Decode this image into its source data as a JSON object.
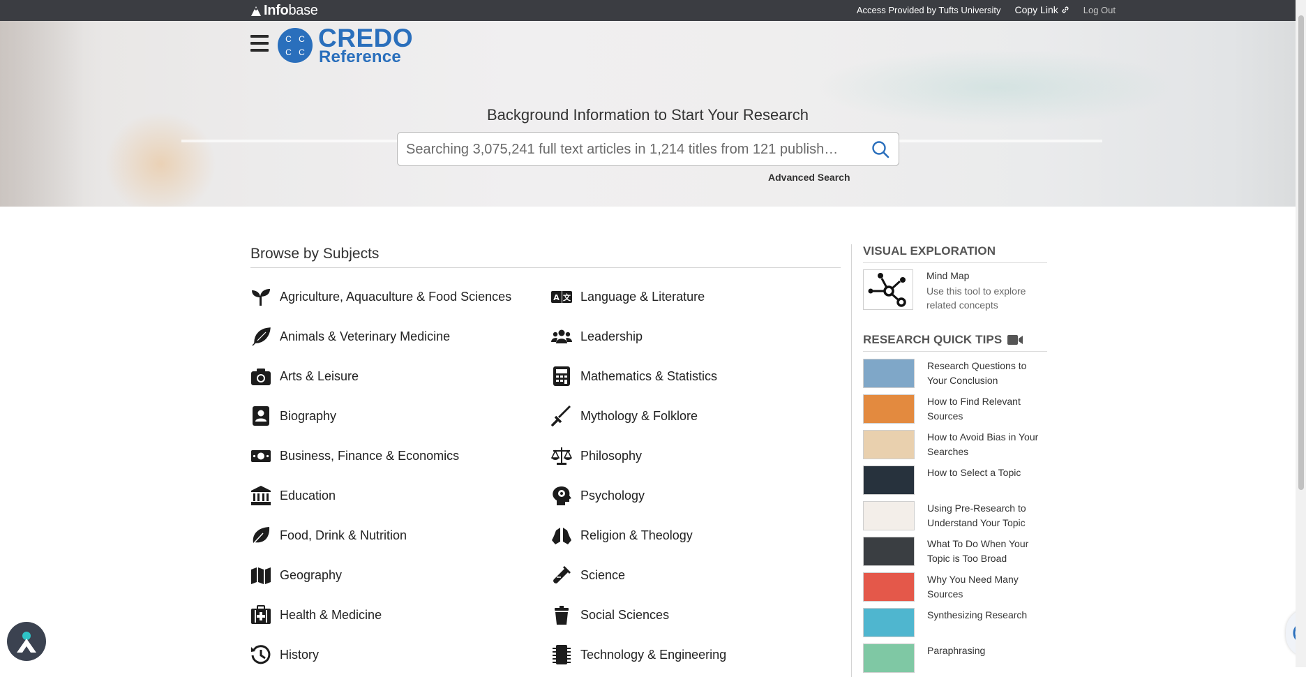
{
  "topbar": {
    "brand_bold": "Info",
    "brand_light": "base",
    "access_text": "Access Provided by Tufts University",
    "copy_link": "Copy Link",
    "logout": "Log Out"
  },
  "logo": {
    "line1": "CREDO",
    "line2": "Reference",
    "monogram": [
      "C",
      "C",
      "C",
      "C"
    ]
  },
  "hero": {
    "title": "Background Information to Start Your Research",
    "search_placeholder": "Searching 3,075,241 full text articles in 1,214 titles from 121 publish…",
    "advanced_search": "Advanced Search"
  },
  "browse": {
    "title": "Browse by Subjects",
    "left": [
      {
        "label": "Agriculture, Aquaculture & Food Sciences",
        "icon": "seedling-icon"
      },
      {
        "label": "Animals & Veterinary Medicine",
        "icon": "feather-icon"
      },
      {
        "label": "Arts & Leisure",
        "icon": "camera-icon"
      },
      {
        "label": "Biography",
        "icon": "address-book-icon"
      },
      {
        "label": "Business, Finance & Economics",
        "icon": "money-bill-icon"
      },
      {
        "label": "Education",
        "icon": "university-icon"
      },
      {
        "label": "Food, Drink & Nutrition",
        "icon": "leaf-icon"
      },
      {
        "label": "Geography",
        "icon": "map-icon"
      },
      {
        "label": "Health & Medicine",
        "icon": "medkit-icon"
      },
      {
        "label": "History",
        "icon": "history-icon"
      }
    ],
    "right": [
      {
        "label": "Language & Literature",
        "icon": "language-icon"
      },
      {
        "label": "Leadership",
        "icon": "users-icon"
      },
      {
        "label": "Mathematics & Statistics",
        "icon": "calculator-icon"
      },
      {
        "label": "Mythology & Folklore",
        "icon": "sword-icon"
      },
      {
        "label": "Philosophy",
        "icon": "balance-scale-icon"
      },
      {
        "label": "Psychology",
        "icon": "brain-head-icon"
      },
      {
        "label": "Religion & Theology",
        "icon": "praying-hands-icon"
      },
      {
        "label": "Science",
        "icon": "test-tube-icon"
      },
      {
        "label": "Social Sciences",
        "icon": "trash-cup-icon"
      },
      {
        "label": "Technology & Engineering",
        "icon": "microchip-icon"
      }
    ]
  },
  "sidebar": {
    "visual_heading": "VISUAL EXPLORATION",
    "mindmap_title": "Mind Map",
    "mindmap_desc": "Use this tool to explore related concepts",
    "tips_heading": "RESEARCH QUICK TIPS",
    "tips": [
      {
        "label": "Research Questions to Your Conclusion",
        "bg": "#7fa7c8"
      },
      {
        "label": "How to Find Relevant Sources",
        "bg": "#e38a3f"
      },
      {
        "label": "How to Avoid Bias in Your Searches",
        "bg": "#e9d0ae"
      },
      {
        "label": "How to Select a Topic",
        "bg": "#27323d"
      },
      {
        "label": "Using Pre-Research to Understand Your Topic",
        "bg": "#f3eee9"
      },
      {
        "label": "What To Do When Your Topic is Too Broad",
        "bg": "#3a3e42"
      },
      {
        "label": "Why You Need Many Sources",
        "bg": "#e4584a"
      },
      {
        "label": "Synthesizing Research",
        "bg": "#4fb6cf"
      },
      {
        "label": "Paraphrasing",
        "bg": "#7fc8a4"
      }
    ]
  }
}
